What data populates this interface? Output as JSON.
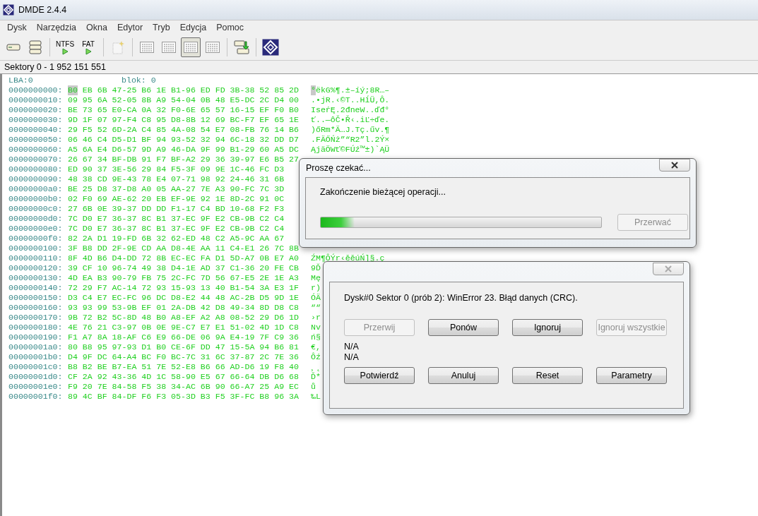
{
  "window": {
    "title": "DMDE 2.4.4"
  },
  "menu": [
    "Dysk",
    "Narzędzia",
    "Okna",
    "Edytor",
    "Tryb",
    "Edycja",
    "Pomoc"
  ],
  "toolbar": [
    {
      "kind": "drive",
      "selected": false
    },
    {
      "kind": "drives",
      "selected": false
    },
    {
      "kind": "separator"
    },
    {
      "kind": "run",
      "label": "NTFS",
      "selected": false
    },
    {
      "kind": "run",
      "label": "FAT",
      "selected": false
    },
    {
      "kind": "separator"
    },
    {
      "kind": "sparkle",
      "selected": false
    },
    {
      "kind": "separator"
    },
    {
      "kind": "panel",
      "selected": false
    },
    {
      "kind": "panel",
      "selected": false
    },
    {
      "kind": "panel",
      "selected": true
    },
    {
      "kind": "panel",
      "selected": false
    },
    {
      "kind": "separator"
    },
    {
      "kind": "export",
      "selected": false
    },
    {
      "kind": "separator"
    },
    {
      "kind": "logo",
      "selected": false
    }
  ],
  "sectors": "Sektory 0 - 1 952 151 551",
  "hex_view": {
    "lba": "LBA:0",
    "block": "blok: 0",
    "rows": [
      {
        "offset": "0000000000:",
        "hex": "B0 EB 6B 47-25 B6 1E B1-96 ED FD 3B-38 52 85 2D",
        "ascii": "°ëkG%¶.±–íý;8R…–",
        "cursor": true
      },
      {
        "offset": "0000000010:",
        "hex": "09 95 6A 52-05 8B A9 54-04 0B 48 E5-DC 2C D4 00",
        "ascii": ".•jR.‹©T..HĺÜ,Ô.",
        "cursor": false
      },
      {
        "offset": "0000000020:",
        "hex": "BE 73 65 E0-CA 0A 32 F0-6E 65 57 16-15 EF F0 B0",
        "ascii": "IseŕĘ.2đneW..ďđ°",
        "cursor": false
      },
      {
        "offset": "0000000030:",
        "hex": "9D 1F 07 97-F4 C8 95 D8-8B 12 69 BC-F7 EF 65 1E",
        "ascii": "ť..—ôČ•Ř‹.iĽ÷ďe.",
        "cursor": false
      },
      {
        "offset": "0000000040:",
        "hex": "29 F5 52 6D-2A C4 85 4A-08 54 E7 08-FB 76 14 B6",
        "ascii": ")őRm*Ä…J.Tç.űv.¶",
        "cursor": false
      },
      {
        "offset": "0000000050:",
        "hex": "06 46 C4 D5-D1 BF 94 93-52 32 94 6C-18 32 DD D7",
        "ascii": ".FÄŐŃż”“R2”l.2Ý×",
        "cursor": false
      },
      {
        "offset": "0000000060:",
        "hex": "A5 6A E4 D6-57 9D A9 46-DA 9F 99 B1-29 60 A5 DC",
        "ascii": "ĄjäÖWť©FÚź™±)`ĄÜ",
        "cursor": false
      },
      {
        "offset": "0000000070:",
        "hex": "26 67 34 BF-DB 91 F7 BF-A2 29 36 39-97 E6 B5 27",
        "cursor": false
      },
      {
        "offset": "0000000080:",
        "hex": "ED 90 37 3E-56 29 84 F5-3F 09 9E 1C-46 FC D3",
        "cursor": false
      },
      {
        "offset": "0000000090:",
        "hex": "48 38 CD 9E-43 78 E4 07-71 98 92 24-46 31 6B",
        "cursor": false
      },
      {
        "offset": "00000000a0:",
        "hex": "BE 25 D8 37-D8 A0 05 AA-27 7E A3 90-FC 7C 3D",
        "cursor": false
      },
      {
        "offset": "00000000b0:",
        "hex": "02 F0 69 AE-62 20 EB EF-9E 92 1E 8D-2C 91 0C",
        "cursor": false
      },
      {
        "offset": "00000000c0:",
        "hex": "27 6B 0E 39-37 DD DD F1-17 C4 BD 10-68 F2 F3",
        "cursor": false
      },
      {
        "offset": "00000000d0:",
        "hex": "7C D0 E7 36-37 8C B1 37-EC 9F E2 CB-9B C2 C4",
        "cursor": false
      },
      {
        "offset": "00000000e0:",
        "hex": "7C D0 E7 36-37 8C B1 37-EC 9F E2 CB-9B C2 C4",
        "cursor": false
      },
      {
        "offset": "00000000f0:",
        "hex": "82 2A D1 19-FD 6B 32 62-ED 48 C2 A5-9C AA 67",
        "cursor": false
      },
      {
        "offset": "0000000100:",
        "hex": "3F B8 DD 2F-9E CD AA D8-4E AA 11 C4-E1 26 7C 8B",
        "cursor": false
      },
      {
        "offset": "0000000110:",
        "hex": "8F 4D B6 D4-DD 72 8B EC-EC FA D1 5D-A7 0B E7 A0",
        "ascii": "ŹM¶ÔÝr‹ěěúŃ]§.ç",
        "cursor": false
      },
      {
        "offset": "0000000120:",
        "hex": "39 CF 10 96-74 49 38 D4-1E AD 37 C1-36 20 FE CB",
        "ascii": "9Ď",
        "cursor": false
      },
      {
        "offset": "0000000130:",
        "hex": "4D EA B3 90-79 FB 75 2C-FC 7D 56 67-E5 2E 1E A3",
        "ascii": "Mę",
        "cursor": false
      },
      {
        "offset": "0000000140:",
        "hex": "72 29 F7 AC-14 72 93 15-93 13 40 B1-54 3A E3 1F",
        "ascii": "r)",
        "cursor": false
      },
      {
        "offset": "0000000150:",
        "hex": "D3 C4 E7 EC-FC 96 DC D8-E2 44 48 AC-2B D5 9D 1E",
        "ascii": "ÓÄ",
        "cursor": false
      },
      {
        "offset": "0000000160:",
        "hex": "93 93 99 53-9B EF 01 2A-DB 42 D8 49-34 8D D8 C8",
        "ascii": "““",
        "cursor": false
      },
      {
        "offset": "0000000170:",
        "hex": "9B 72 B2 5C-8D 48 B0 A8-EF A2 A8 08-52 29 D6 1D",
        "ascii": "›r",
        "cursor": false
      },
      {
        "offset": "0000000180:",
        "hex": "4E 76 21 C3-97 0B 0E 9E-C7 E7 E1 51-02 4D 1D C8",
        "ascii": "Nv",
        "cursor": false
      },
      {
        "offset": "0000000190:",
        "hex": "F1 A7 8A 18-AF C6 E9 66-DE 06 9A E4-19 7F C9 36",
        "ascii": "ń§",
        "cursor": false
      },
      {
        "offset": "00000001a0:",
        "hex": "80 B8 95 97-93 D1 B0 CE-6F DD 47 15-5A 94 B6 81",
        "ascii": "€,",
        "cursor": false
      },
      {
        "offset": "00000001b0:",
        "hex": "D4 9F DC 64-A4 BC F0 BC-7C 31 6C 37-87 2C 7E 36",
        "ascii": "Ôź",
        "cursor": false
      },
      {
        "offset": "00000001c0:",
        "hex": "B8 B2 BE B7-EA 51 7E 52-E8 B6 66 AD-D6 19 F8 40",
        "ascii": "¸˛",
        "cursor": false
      },
      {
        "offset": "00000001d0:",
        "hex": "CF 2A 92 43-36 4D 1C 58-90 E5 67 66-64 DB D6 68",
        "ascii": "Ď*",
        "cursor": false
      },
      {
        "offset": "00000001e0:",
        "hex": "F9 20 7E 84-58 F5 38 34-AC 6B 90 66-A7 25 A9 EC",
        "ascii": "ů",
        "cursor": false
      },
      {
        "offset": "00000001f0:",
        "hex": "89 4C BF 84-DF F6 F3 05-3D B3 F5 3F-FC B8 96 3A",
        "ascii": "‰L",
        "cursor": false
      }
    ]
  },
  "wait_dialog": {
    "title": "Proszę czekać...",
    "message": "Zakończenie bieżącej operacji...",
    "level": 0.12,
    "button": {
      "label": "Przerwać",
      "disabled": true
    }
  },
  "error_dialog": {
    "message": "Dysk#0 Sektor 0 (prób 2): WinError 23. Błąd danych (CRC).",
    "buttons": [
      {
        "label": "Przerwij",
        "disabled": true
      },
      {
        "label": "Ponów",
        "disabled": false
      },
      {
        "label": "Ignoruj",
        "disabled": false
      },
      {
        "label": "Ignoruj wszystkie",
        "disabled": true
      }
    ],
    "info": [
      "N/A",
      "N/A"
    ],
    "actions": [
      {
        "label": "Potwierdź",
        "disabled": false
      },
      {
        "label": "Anuluj",
        "disabled": false
      },
      {
        "label": "Reset",
        "disabled": false
      },
      {
        "label": "Parametry",
        "disabled": false
      }
    ]
  }
}
